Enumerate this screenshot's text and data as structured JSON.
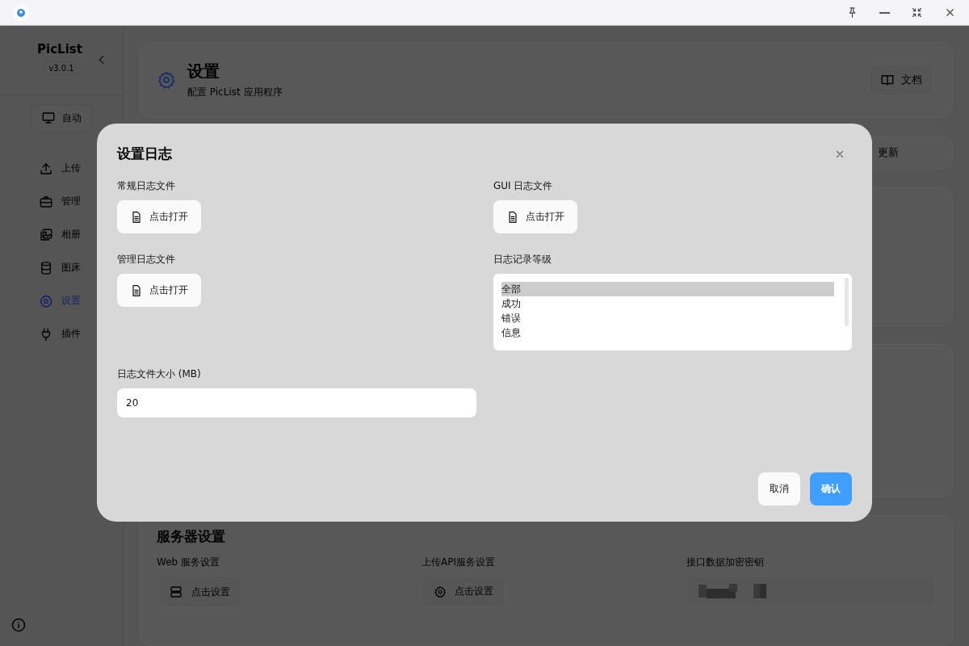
{
  "sidebar": {
    "app_name": "PicList",
    "version": "v3.0.1",
    "mode_button": "自动",
    "items": [
      {
        "label": "上传",
        "selected": false
      },
      {
        "label": "管理",
        "selected": false
      },
      {
        "label": "相册",
        "selected": false
      },
      {
        "label": "图床",
        "selected": false
      },
      {
        "label": "设置",
        "selected": true
      },
      {
        "label": "插件",
        "selected": false
      }
    ]
  },
  "header": {
    "title": "设置",
    "subtitle": "配置 PicList 应用程序",
    "docs_button": "文档"
  },
  "tab_bar": {
    "partial_tab": "更新"
  },
  "server_section": {
    "title": "服务器设置",
    "items": [
      {
        "kind": "button",
        "label": "Web 服务设置",
        "button": "点击设置"
      },
      {
        "kind": "button",
        "label": "上传API服务设置",
        "button": "点击设置"
      },
      {
        "kind": "secret",
        "label": "接口数据加密密钥"
      }
    ]
  },
  "dialog": {
    "title": "设置日志",
    "files": [
      {
        "label": "常规日志文件",
        "button": "点击打开"
      },
      {
        "label": "GUI 日志文件",
        "button": "点击打开"
      },
      {
        "label": "管理日志文件",
        "button": "点击打开"
      }
    ],
    "level": {
      "label": "日志记录等级",
      "options": [
        {
          "label": "全部",
          "selected": true
        },
        {
          "label": "成功",
          "selected": false
        },
        {
          "label": "错误",
          "selected": false
        },
        {
          "label": "信息",
          "selected": false
        }
      ]
    },
    "size": {
      "label": "日志文件大小 (MB)",
      "value": "20"
    },
    "cancel": "取消",
    "confirm": "确认"
  }
}
